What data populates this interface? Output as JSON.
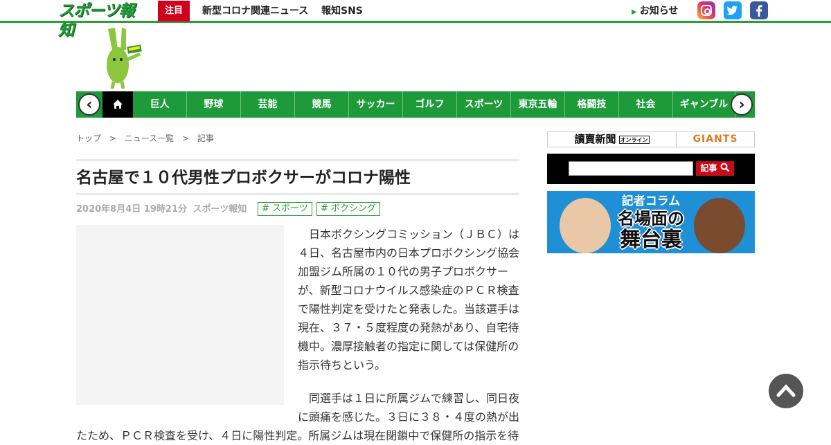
{
  "header": {
    "logo": "スポーツ報知",
    "highlight_label": "注目",
    "links": [
      "新型コロナ関連ニュース",
      "報知SNS"
    ],
    "notice": "お知らせ",
    "sns": [
      "instagram-icon",
      "twitter-icon",
      "facebook-icon"
    ]
  },
  "nav": {
    "items": [
      "巨人",
      "野球",
      "芸能",
      "競馬",
      "サッカー",
      "ゴルフ",
      "スポーツ",
      "東京五輪",
      "格闘技",
      "社会",
      "ギャンブル"
    ],
    "prev": "‹",
    "next": "›"
  },
  "breadcrumb": [
    "トップ",
    ">",
    "ニュース一覧",
    ">",
    "記事"
  ],
  "article": {
    "title": "名古屋で１０代男性プロボクサーがコロナ陽性",
    "date": "2020年8月4日 19時21分",
    "source": "スポーツ報知",
    "tags": [
      "# スポーツ",
      "# ボクシング"
    ],
    "paragraph1_lines": [
      "日本ボクシングコミッション（ＪＢＣ）は",
      "４日、名古屋市内の日本プロボクシング協会",
      "加盟ジム所属の１０代の男子プロボクサー",
      "が、新型コロナウイルス感染症のＰＣＲ検査",
      "で陽性判定を受けたと発表した。当該選手は",
      "現在、３７・５度程度の発熱があり、自宅待",
      "機中。濃厚接触者の指定に関しては保健所の",
      "指示待ちという。"
    ],
    "paragraph2_lines": [
      "同選手は１日に所属ジムで練習し、同日夜",
      "に頭痛を感じた。３日に３８・４度の熱が出",
      "たため、ＰＣＲ検査を受け、４日に陽性判定。所属ジムは現在閉鎖中で保健所の指示を待"
    ]
  },
  "sidebar": {
    "yomiuri": "讀賣新聞",
    "yomiuri_sub": "オンライン",
    "giants": "GIANTS",
    "search_button": "記事",
    "banner_line1": "記者コラム",
    "banner_line2": "名場面の",
    "banner_line3": "舞台裏"
  },
  "colors": {
    "brand_green": "#1e9a3a",
    "highlight_red": "#d0021b",
    "banner_blue": "#1f8fd6"
  }
}
